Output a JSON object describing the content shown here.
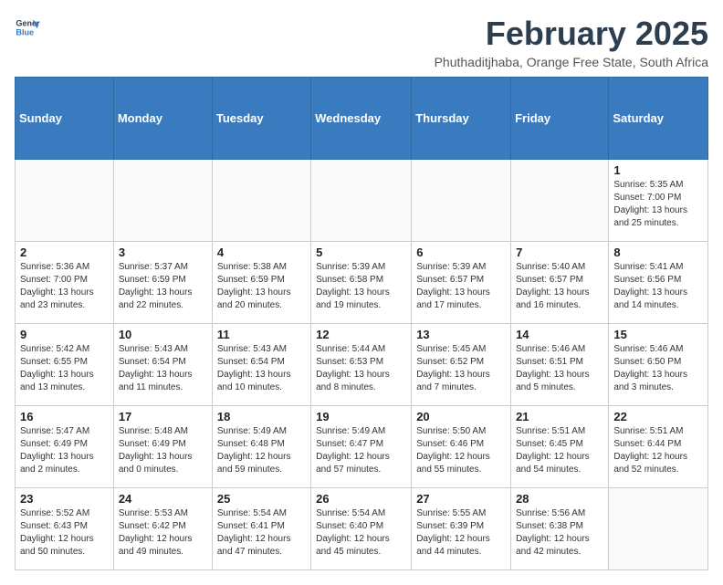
{
  "header": {
    "logo_line1": "General",
    "logo_line2": "Blue",
    "month_title": "February 2025",
    "subtitle": "Phuthaditjhaba, Orange Free State, South Africa"
  },
  "weekdays": [
    "Sunday",
    "Monday",
    "Tuesday",
    "Wednesday",
    "Thursday",
    "Friday",
    "Saturday"
  ],
  "weeks": [
    [
      {
        "day": "",
        "info": ""
      },
      {
        "day": "",
        "info": ""
      },
      {
        "day": "",
        "info": ""
      },
      {
        "day": "",
        "info": ""
      },
      {
        "day": "",
        "info": ""
      },
      {
        "day": "",
        "info": ""
      },
      {
        "day": "1",
        "info": "Sunrise: 5:35 AM\nSunset: 7:00 PM\nDaylight: 13 hours\nand 25 minutes."
      }
    ],
    [
      {
        "day": "2",
        "info": "Sunrise: 5:36 AM\nSunset: 7:00 PM\nDaylight: 13 hours\nand 23 minutes."
      },
      {
        "day": "3",
        "info": "Sunrise: 5:37 AM\nSunset: 6:59 PM\nDaylight: 13 hours\nand 22 minutes."
      },
      {
        "day": "4",
        "info": "Sunrise: 5:38 AM\nSunset: 6:59 PM\nDaylight: 13 hours\nand 20 minutes."
      },
      {
        "day": "5",
        "info": "Sunrise: 5:39 AM\nSunset: 6:58 PM\nDaylight: 13 hours\nand 19 minutes."
      },
      {
        "day": "6",
        "info": "Sunrise: 5:39 AM\nSunset: 6:57 PM\nDaylight: 13 hours\nand 17 minutes."
      },
      {
        "day": "7",
        "info": "Sunrise: 5:40 AM\nSunset: 6:57 PM\nDaylight: 13 hours\nand 16 minutes."
      },
      {
        "day": "8",
        "info": "Sunrise: 5:41 AM\nSunset: 6:56 PM\nDaylight: 13 hours\nand 14 minutes."
      }
    ],
    [
      {
        "day": "9",
        "info": "Sunrise: 5:42 AM\nSunset: 6:55 PM\nDaylight: 13 hours\nand 13 minutes."
      },
      {
        "day": "10",
        "info": "Sunrise: 5:43 AM\nSunset: 6:54 PM\nDaylight: 13 hours\nand 11 minutes."
      },
      {
        "day": "11",
        "info": "Sunrise: 5:43 AM\nSunset: 6:54 PM\nDaylight: 13 hours\nand 10 minutes."
      },
      {
        "day": "12",
        "info": "Sunrise: 5:44 AM\nSunset: 6:53 PM\nDaylight: 13 hours\nand 8 minutes."
      },
      {
        "day": "13",
        "info": "Sunrise: 5:45 AM\nSunset: 6:52 PM\nDaylight: 13 hours\nand 7 minutes."
      },
      {
        "day": "14",
        "info": "Sunrise: 5:46 AM\nSunset: 6:51 PM\nDaylight: 13 hours\nand 5 minutes."
      },
      {
        "day": "15",
        "info": "Sunrise: 5:46 AM\nSunset: 6:50 PM\nDaylight: 13 hours\nand 3 minutes."
      }
    ],
    [
      {
        "day": "16",
        "info": "Sunrise: 5:47 AM\nSunset: 6:49 PM\nDaylight: 13 hours\nand 2 minutes."
      },
      {
        "day": "17",
        "info": "Sunrise: 5:48 AM\nSunset: 6:49 PM\nDaylight: 13 hours\nand 0 minutes."
      },
      {
        "day": "18",
        "info": "Sunrise: 5:49 AM\nSunset: 6:48 PM\nDaylight: 12 hours\nand 59 minutes."
      },
      {
        "day": "19",
        "info": "Sunrise: 5:49 AM\nSunset: 6:47 PM\nDaylight: 12 hours\nand 57 minutes."
      },
      {
        "day": "20",
        "info": "Sunrise: 5:50 AM\nSunset: 6:46 PM\nDaylight: 12 hours\nand 55 minutes."
      },
      {
        "day": "21",
        "info": "Sunrise: 5:51 AM\nSunset: 6:45 PM\nDaylight: 12 hours\nand 54 minutes."
      },
      {
        "day": "22",
        "info": "Sunrise: 5:51 AM\nSunset: 6:44 PM\nDaylight: 12 hours\nand 52 minutes."
      }
    ],
    [
      {
        "day": "23",
        "info": "Sunrise: 5:52 AM\nSunset: 6:43 PM\nDaylight: 12 hours\nand 50 minutes."
      },
      {
        "day": "24",
        "info": "Sunrise: 5:53 AM\nSunset: 6:42 PM\nDaylight: 12 hours\nand 49 minutes."
      },
      {
        "day": "25",
        "info": "Sunrise: 5:54 AM\nSunset: 6:41 PM\nDaylight: 12 hours\nand 47 minutes."
      },
      {
        "day": "26",
        "info": "Sunrise: 5:54 AM\nSunset: 6:40 PM\nDaylight: 12 hours\nand 45 minutes."
      },
      {
        "day": "27",
        "info": "Sunrise: 5:55 AM\nSunset: 6:39 PM\nDaylight: 12 hours\nand 44 minutes."
      },
      {
        "day": "28",
        "info": "Sunrise: 5:56 AM\nSunset: 6:38 PM\nDaylight: 12 hours\nand 42 minutes."
      },
      {
        "day": "",
        "info": ""
      }
    ]
  ]
}
